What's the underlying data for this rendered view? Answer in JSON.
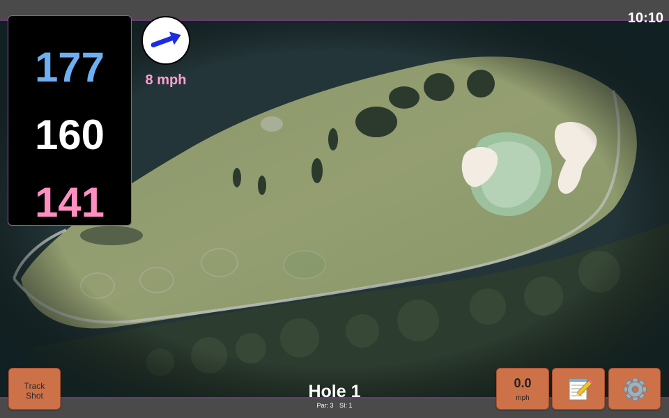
{
  "status": {
    "time": "10:10"
  },
  "distances": {
    "back": "177",
    "middle": "160",
    "front": "141"
  },
  "wind": {
    "speed": "8 mph",
    "icon": "wind-arrow-icon"
  },
  "hole": {
    "title": "Hole 1",
    "par": "Par: 3",
    "si": "SI: 1"
  },
  "buttons": {
    "track_shot": [
      "Track",
      "Shot"
    ],
    "speed_value": "0.0",
    "speed_unit": "mph",
    "notes_icon": "notepad-icon",
    "settings_icon": "gear-icon"
  },
  "colors": {
    "back_distance": "#6eaef2",
    "middle_distance": "#ffffff",
    "front_distance": "#ff8fc1",
    "wind_text": "#ff9fd6",
    "button": "#cd7149",
    "bar": "#4a4a4a",
    "accent_border": "#8e5ea5"
  }
}
